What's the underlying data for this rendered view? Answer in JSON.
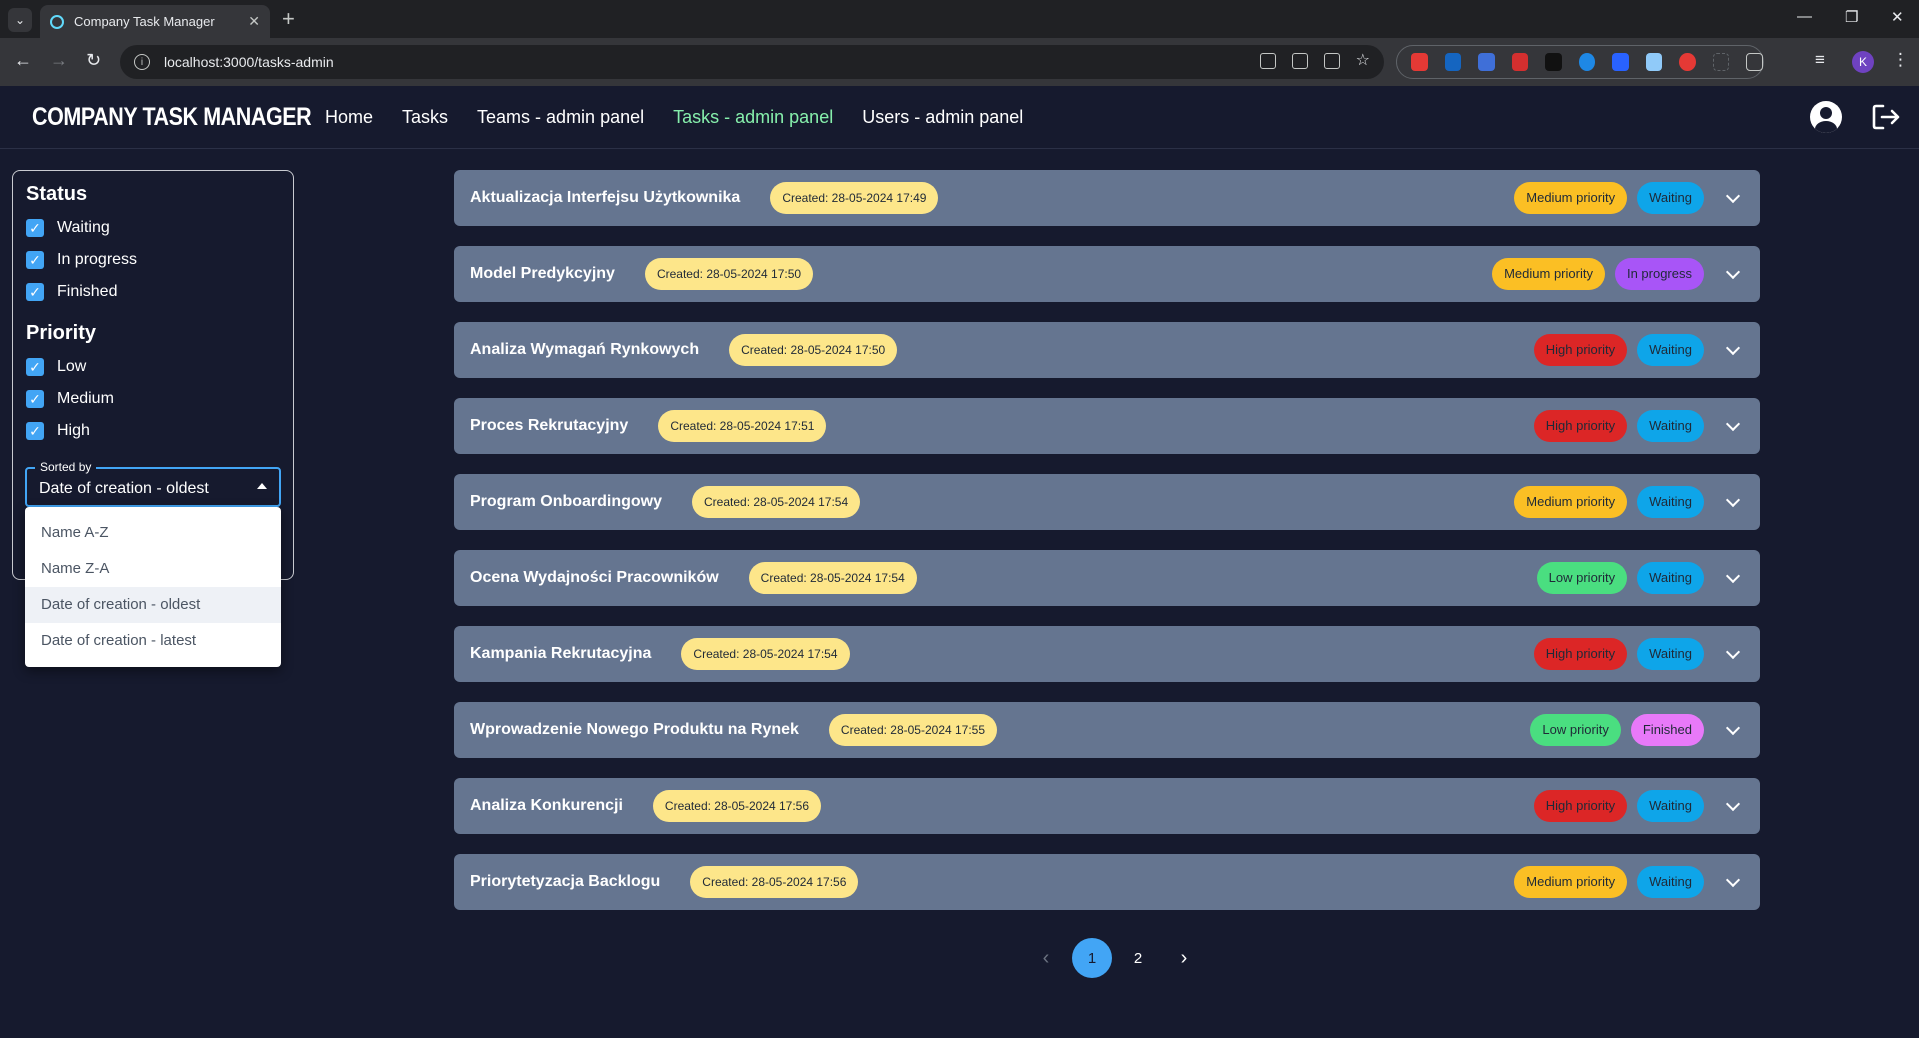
{
  "browser": {
    "tab_title": "Company Task Manager",
    "url": "localhost:3000/tasks-admin",
    "profile_initial": "K"
  },
  "app": {
    "brand": "COMPANY TASK MANAGER",
    "nav": [
      {
        "label": "Home",
        "active": false
      },
      {
        "label": "Tasks",
        "active": false
      },
      {
        "label": "Teams - admin panel",
        "active": false
      },
      {
        "label": "Tasks - admin panel",
        "active": true
      },
      {
        "label": "Users - admin panel",
        "active": false
      }
    ],
    "active_color": "#86efac"
  },
  "filters": {
    "status_title": "Status",
    "status": [
      {
        "label": "Waiting",
        "checked": true
      },
      {
        "label": "In progress",
        "checked": true
      },
      {
        "label": "Finished",
        "checked": true
      }
    ],
    "priority_title": "Priority",
    "priority": [
      {
        "label": "Low",
        "checked": true
      },
      {
        "label": "Medium",
        "checked": true
      },
      {
        "label": "High",
        "checked": true
      }
    ],
    "sort_label": "Sorted by",
    "sort_value": "Date of creation - oldest",
    "sort_options": [
      {
        "label": "Name A-Z",
        "selected": false
      },
      {
        "label": "Name Z-A",
        "selected": false
      },
      {
        "label": "Date of creation - oldest",
        "selected": true
      },
      {
        "label": "Date of creation - latest",
        "selected": false
      }
    ]
  },
  "tasks": [
    {
      "name": "Aktualizacja Interfejsu Użytkownika",
      "created": "Created: 28-05-2024 17:49",
      "priority": "Medium priority",
      "priority_level": "medium",
      "status": "Waiting",
      "status_level": "waiting"
    },
    {
      "name": "Model Predykcyjny",
      "created": "Created: 28-05-2024 17:50",
      "priority": "Medium priority",
      "priority_level": "medium",
      "status": "In progress",
      "status_level": "progress"
    },
    {
      "name": "Analiza Wymagań Rynkowych",
      "created": "Created: 28-05-2024 17:50",
      "priority": "High priority",
      "priority_level": "high",
      "status": "Waiting",
      "status_level": "waiting"
    },
    {
      "name": "Proces Rekrutacyjny",
      "created": "Created: 28-05-2024 17:51",
      "priority": "High priority",
      "priority_level": "high",
      "status": "Waiting",
      "status_level": "waiting"
    },
    {
      "name": "Program Onboardingowy",
      "created": "Created: 28-05-2024 17:54",
      "priority": "Medium priority",
      "priority_level": "medium",
      "status": "Waiting",
      "status_level": "waiting"
    },
    {
      "name": "Ocena Wydajności Pracowników",
      "created": "Created: 28-05-2024 17:54",
      "priority": "Low priority",
      "priority_level": "low",
      "status": "Waiting",
      "status_level": "waiting"
    },
    {
      "name": "Kampania Rekrutacyjna",
      "created": "Created: 28-05-2024 17:54",
      "priority": "High priority",
      "priority_level": "high",
      "status": "Waiting",
      "status_level": "waiting"
    },
    {
      "name": "Wprowadzenie Nowego Produktu na Rynek",
      "created": "Created: 28-05-2024 17:55",
      "priority": "Low priority",
      "priority_level": "low",
      "status": "Finished",
      "status_level": "finished"
    },
    {
      "name": "Analiza Konkurencji",
      "created": "Created: 28-05-2024 17:56",
      "priority": "High priority",
      "priority_level": "high",
      "status": "Waiting",
      "status_level": "waiting"
    },
    {
      "name": "Priorytetyzacja Backlogu",
      "created": "Created: 28-05-2024 17:56",
      "priority": "Medium priority",
      "priority_level": "medium",
      "status": "Waiting",
      "status_level": "waiting"
    }
  ],
  "pagination": {
    "pages": [
      "1",
      "2"
    ],
    "current": "1"
  }
}
